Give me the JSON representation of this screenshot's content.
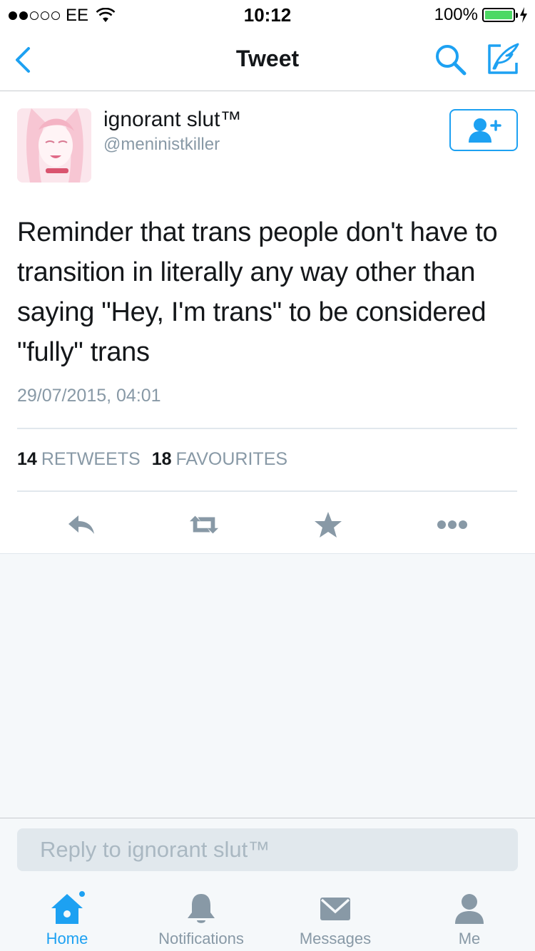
{
  "status_bar": {
    "carrier": "EE",
    "time": "10:12",
    "battery": "100%",
    "signal_bars": 2,
    "signal_total": 5
  },
  "nav": {
    "title": "Tweet",
    "back_icon": "chevron-left-icon",
    "search_icon": "search-icon",
    "compose_icon": "compose-tweet-icon"
  },
  "tweet": {
    "author_name": "ignorant slut™",
    "author_handle": "@meninistkiller",
    "text": "Reminder that trans people don't have to transition in literally any way other than saying \"Hey, I'm trans\" to be considered \"fully\" trans",
    "timestamp": "29/07/2015, 04:01",
    "retweet_count": "14",
    "retweet_label": "RETWEETS",
    "favourite_count": "18",
    "favourite_label": "FAVOURITES"
  },
  "actions": {
    "reply": "reply-icon",
    "retweet": "retweet-icon",
    "favourite": "star-icon",
    "more": "more-icon"
  },
  "reply_bar": {
    "placeholder": "Reply to ignorant slut™"
  },
  "tab_bar": {
    "items": [
      {
        "label": "Home",
        "icon": "home-icon",
        "active": true
      },
      {
        "label": "Notifications",
        "icon": "bell-icon",
        "active": false
      },
      {
        "label": "Messages",
        "icon": "envelope-icon",
        "active": false
      },
      {
        "label": "Me",
        "icon": "person-icon",
        "active": false
      }
    ]
  },
  "colors": {
    "accent": "#1da1f2",
    "secondary_text": "#8899a6",
    "icon_gray": "#8899a6",
    "battery_green": "#4cd964"
  }
}
